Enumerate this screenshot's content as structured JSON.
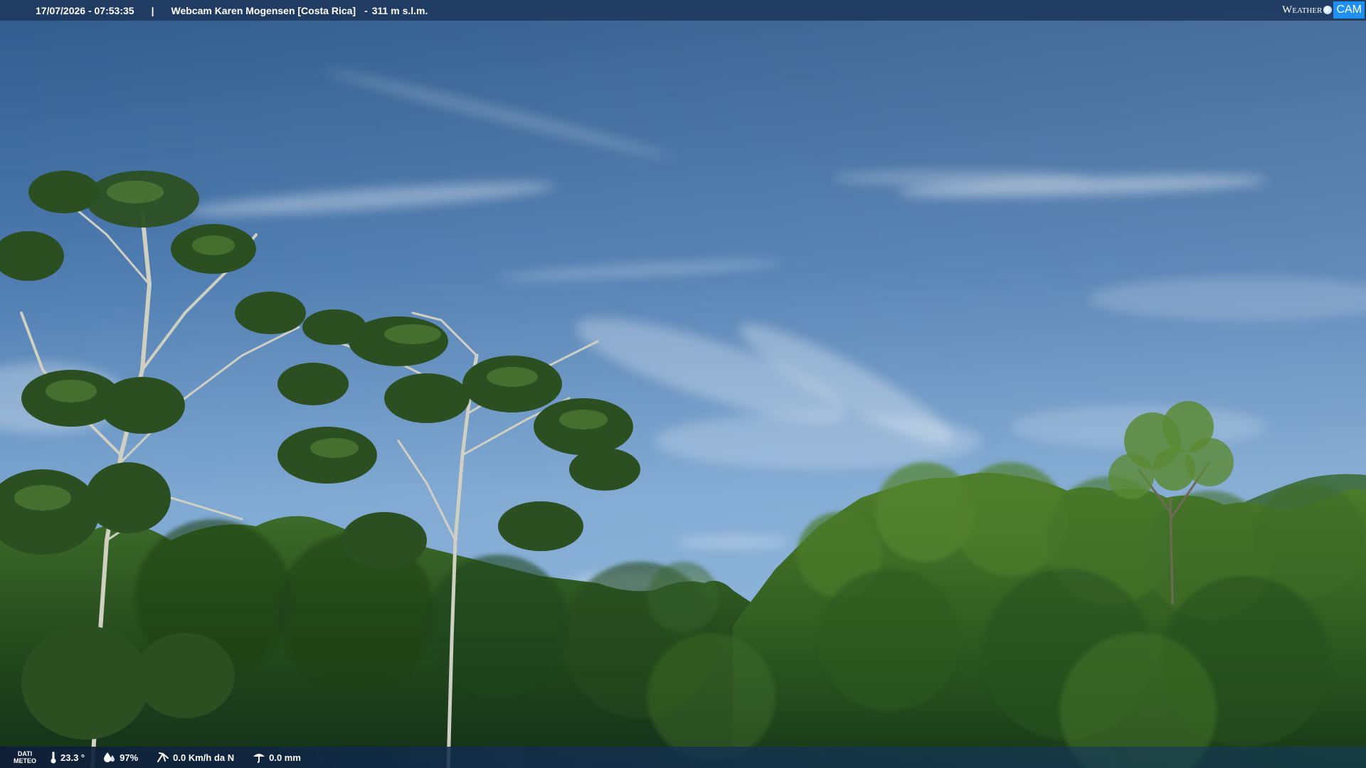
{
  "header": {
    "datetime": "17/07/2026 - 07:53:35",
    "separator": "|",
    "location": "Webcam Karen Mogensen [Costa Rica]",
    "dash": "-",
    "altitude": "311 m s.l.m."
  },
  "logo": {
    "weather": "Weather",
    "cam": "CAM",
    "accent_color": "#1f8ff0"
  },
  "meteo": {
    "label_line1": "DATI",
    "label_line2": "METEO",
    "temperature": "23.3 °",
    "humidity": "97%",
    "wind": "0.0 Km/h da N",
    "rain": "0.0 mm",
    "icons": [
      "thermometer-icon",
      "humidity-drop-icon",
      "wind-icon",
      "rain-icon"
    ]
  },
  "colors": {
    "sky_top": "#2e5a8e",
    "sky_bottom": "#8ab3d8",
    "foliage": "#2f5a23"
  }
}
